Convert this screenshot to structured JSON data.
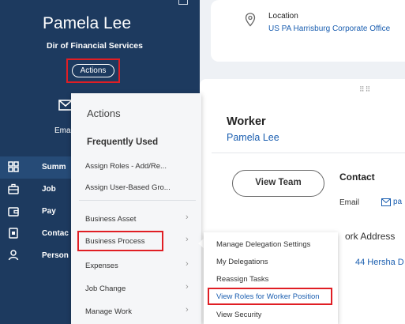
{
  "profile": {
    "name": "Pamela Lee",
    "role": "Dir of Financial Services",
    "actions_label": "Actions",
    "email_short": "Ema"
  },
  "sidebar": {
    "items": [
      {
        "label": "Summ",
        "icon": "summary-grid-icon",
        "active": true
      },
      {
        "label": "Job",
        "icon": "briefcase-icon"
      },
      {
        "label": "Pay",
        "icon": "wallet-icon"
      },
      {
        "label": "Contac",
        "icon": "contact-card-icon"
      },
      {
        "label": "Person",
        "icon": "person-icon"
      }
    ]
  },
  "location_card": {
    "title": "Location",
    "value": "US PA Harrisburg Corporate Office",
    "icon": "location-pin-icon"
  },
  "worker": {
    "title": "Worker",
    "name": "Pamela Lee",
    "view_team_label": "View Team",
    "contact_title": "Contact",
    "email_label": "Email",
    "email_value": "pa",
    "work_address_label": "ork Address",
    "address_value": "44 Hersha D"
  },
  "actions_menu": {
    "header": "Actions",
    "frequently_used": "Frequently Used",
    "frequent": [
      "Assign Roles - Add/Re...",
      "Assign User-Based Gro..."
    ],
    "categories": [
      "Business Asset",
      "Business Process",
      "Expenses",
      "Job Change",
      "Manage Work"
    ]
  },
  "submenu": {
    "items": [
      "Manage Delegation Settings",
      "My Delegations",
      "Reassign Tasks",
      "View Roles for Worker Position",
      "View Security"
    ]
  },
  "colors": {
    "sidebar": "#1d3a5f",
    "highlight": "#e01e24",
    "link": "#1a5eb0"
  }
}
